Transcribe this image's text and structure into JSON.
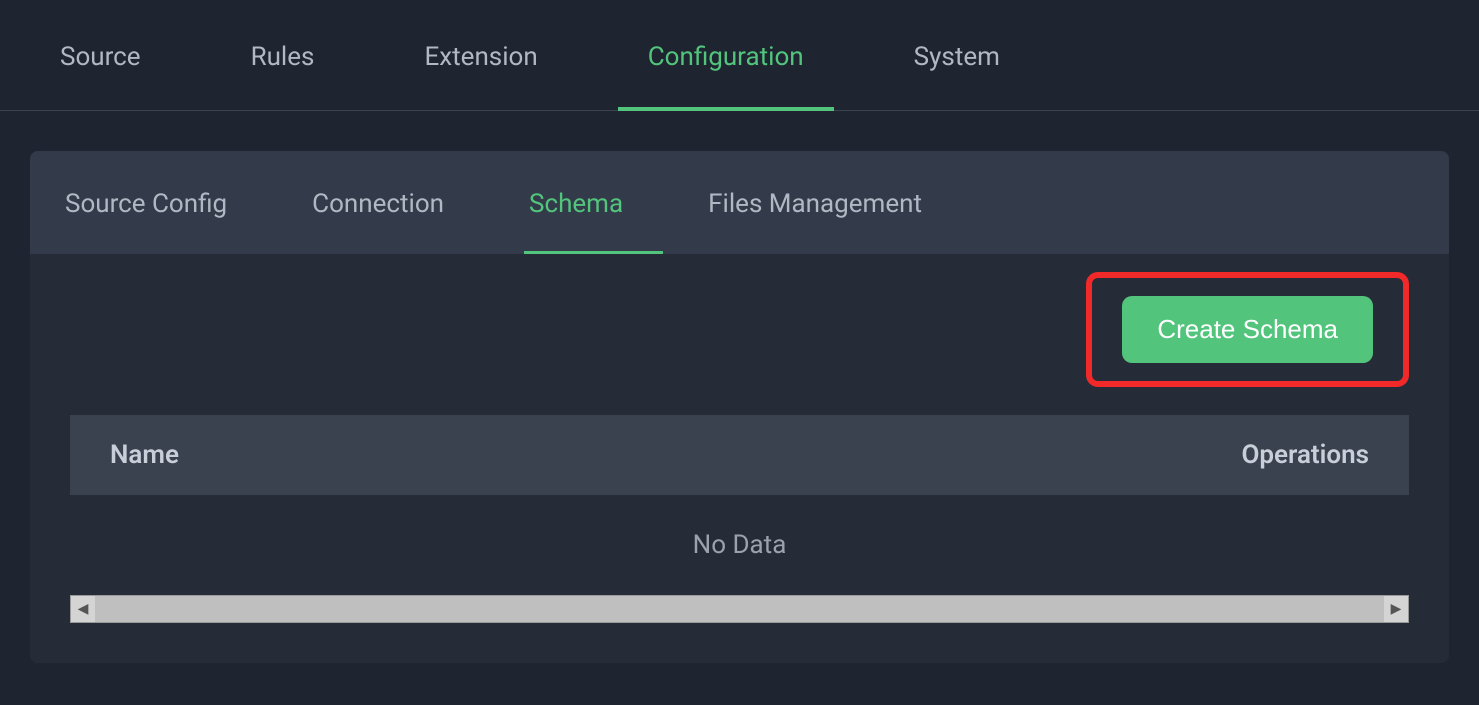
{
  "main_tabs": {
    "source": "Source",
    "rules": "Rules",
    "extension": "Extension",
    "configuration": "Configuration",
    "system": "System",
    "active": "configuration"
  },
  "sub_tabs": {
    "source_config": "Source Config",
    "connection": "Connection",
    "schema": "Schema",
    "files_management": "Files Management",
    "active": "schema"
  },
  "actions": {
    "create_schema": "Create Schema"
  },
  "table": {
    "columns": {
      "name": "Name",
      "operations": "Operations"
    },
    "empty_text": "No Data"
  },
  "colors": {
    "accent": "#52c47c",
    "highlight_border": "#f22929",
    "bg_dark": "#1e2530",
    "bg_panel": "#252c38"
  }
}
